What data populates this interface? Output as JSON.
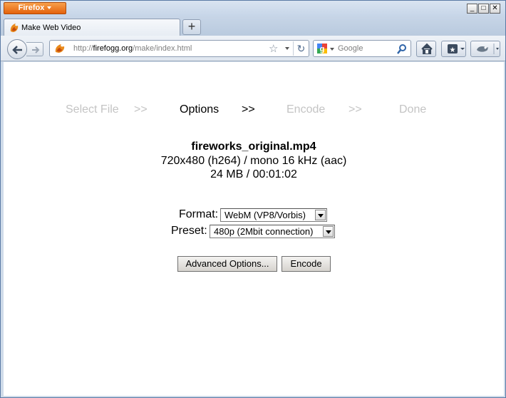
{
  "browser": {
    "menu_label": "Firefox",
    "tab_title": "Make Web Video",
    "new_tab_label": "+",
    "url_prefix": "http://",
    "url_host": "firefogg.org",
    "url_path": "/make/index.html",
    "search_placeholder": "Google",
    "window_controls": {
      "minimize": "_",
      "maximize": "□",
      "close": "✕"
    }
  },
  "steps": [
    {
      "label": "Select File",
      "active": false
    },
    {
      "label": ">>",
      "active": false
    },
    {
      "label": "Options",
      "active": true
    },
    {
      "label": ">>",
      "active": true
    },
    {
      "label": "Encode",
      "active": false
    },
    {
      "label": ">>",
      "active": false
    },
    {
      "label": "Done",
      "active": false
    }
  ],
  "file": {
    "name": "fireworks_original.mp4",
    "details": "720x480 (h264) / mono 16 kHz (aac)",
    "size_duration": "24 MB / 00:01:02"
  },
  "form": {
    "format_label": "Format:",
    "format_value": "WebM (VP8/Vorbis)",
    "preset_label": "Preset:",
    "preset_value": "480p (2Mbit connection)"
  },
  "buttons": {
    "advanced": "Advanced Options...",
    "encode": "Encode"
  },
  "colors": {
    "firefox_orange": "#e4620c",
    "inactive_step": "#c4c4c4",
    "active_step": "#000000"
  }
}
